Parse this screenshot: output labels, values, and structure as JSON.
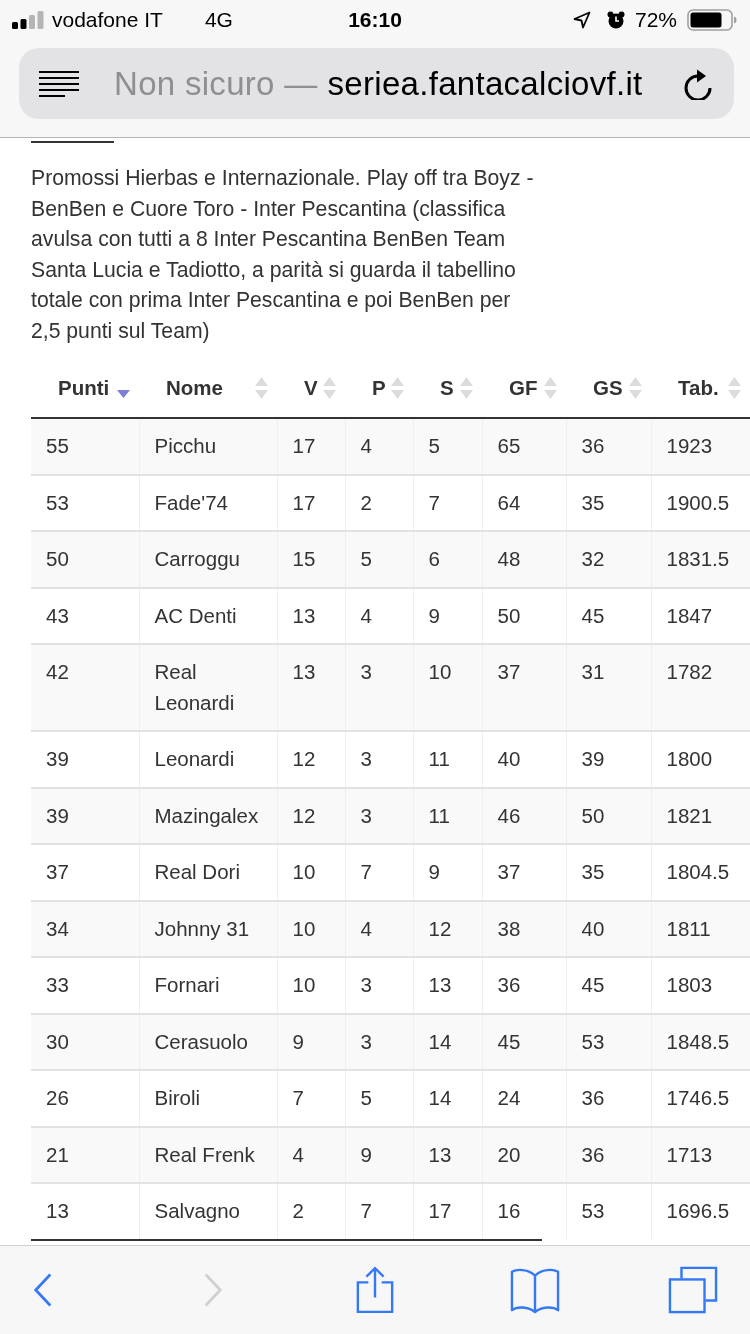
{
  "status_bar": {
    "carrier": "vodafone IT",
    "network": "4G",
    "time": "16:10",
    "battery_percent": "72%"
  },
  "address_bar": {
    "security_label": "Non sicuro —",
    "domain": "seriea.fantacalciovf.it"
  },
  "notice": "Promossi Hierbas e Internazionale. Play off tra Boyz - BenBen e Cuore Toro - Inter Pescantina (classifica avulsa con tutti a 8 Inter Pescantina BenBen Team Santa Lucia e Tadiotto, a parità si guarda il tabellino totale con prima Inter Pescantina e poi BenBen per 2,5 punti sul Team)",
  "table": {
    "columns": [
      {
        "label": "Punti",
        "sorted": true
      },
      {
        "label": "Nome",
        "sorted": false
      },
      {
        "label": "V",
        "sorted": false
      },
      {
        "label": "P",
        "sorted": false
      },
      {
        "label": "S",
        "sorted": false
      },
      {
        "label": "GF",
        "sorted": false
      },
      {
        "label": "GS",
        "sorted": false
      },
      {
        "label": "Tab.",
        "sorted": false
      }
    ],
    "rows": [
      [
        "55",
        "Picchu",
        "17",
        "4",
        "5",
        "65",
        "36",
        "1923"
      ],
      [
        "53",
        "Fade'74",
        "17",
        "2",
        "7",
        "64",
        "35",
        "1900.5"
      ],
      [
        "50",
        "Carroggu",
        "15",
        "5",
        "6",
        "48",
        "32",
        "1831.5"
      ],
      [
        "43",
        "AC Denti",
        "13",
        "4",
        "9",
        "50",
        "45",
        "1847"
      ],
      [
        "42",
        "Real Leonardi",
        "13",
        "3",
        "10",
        "37",
        "31",
        "1782"
      ],
      [
        "39",
        "Leonardi",
        "12",
        "3",
        "11",
        "40",
        "39",
        "1800"
      ],
      [
        "39",
        "Mazingalex",
        "12",
        "3",
        "11",
        "46",
        "50",
        "1821"
      ],
      [
        "37",
        "Real Dori",
        "10",
        "7",
        "9",
        "37",
        "35",
        "1804.5"
      ],
      [
        "34",
        "Johnny 31",
        "10",
        "4",
        "12",
        "38",
        "40",
        "1811"
      ],
      [
        "33",
        "Fornari",
        "10",
        "3",
        "13",
        "36",
        "45",
        "1803"
      ],
      [
        "30",
        "Cerasuolo",
        "9",
        "3",
        "14",
        "45",
        "53",
        "1848.5"
      ],
      [
        "26",
        "Biroli",
        "7",
        "5",
        "14",
        "24",
        "36",
        "1746.5"
      ],
      [
        "21",
        "Real Frenk",
        "4",
        "9",
        "13",
        "20",
        "36",
        "1713"
      ],
      [
        "13",
        "Salvagno",
        "2",
        "7",
        "17",
        "16",
        "53",
        "1696.5"
      ]
    ]
  },
  "toolbar": {
    "back": {
      "disabled": false
    },
    "forward": {
      "disabled": true
    }
  }
}
